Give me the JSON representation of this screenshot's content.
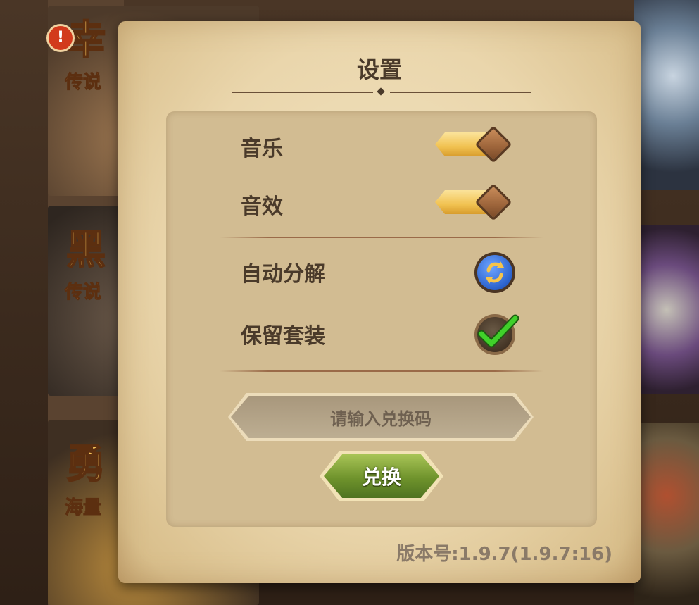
{
  "background": {
    "banners": [
      {
        "title": "幸",
        "subtitle": "传说"
      },
      {
        "title": "黑",
        "subtitle": "传说"
      },
      {
        "title": "勇",
        "subtitle": "海量"
      }
    ],
    "alert_badge": "!"
  },
  "dialog": {
    "title": "设置",
    "settings": [
      {
        "label": "音乐",
        "type": "toggle",
        "on": true
      },
      {
        "label": "音效",
        "type": "toggle",
        "on": true
      },
      {
        "label": "自动分解",
        "type": "button",
        "icon": "recycle-icon"
      },
      {
        "label": "保留套装",
        "type": "checkbox",
        "checked": true
      }
    ],
    "redeem_placeholder": "请输入兑换码",
    "redeem_button": "兑换",
    "version": "版本号:1.9.7(1.9.7:16)"
  },
  "colors": {
    "toggle_track": "#f1c251",
    "redeem_button": "#6f932c",
    "auto_icon": "#2b62cc",
    "check": "#2fc31e"
  }
}
